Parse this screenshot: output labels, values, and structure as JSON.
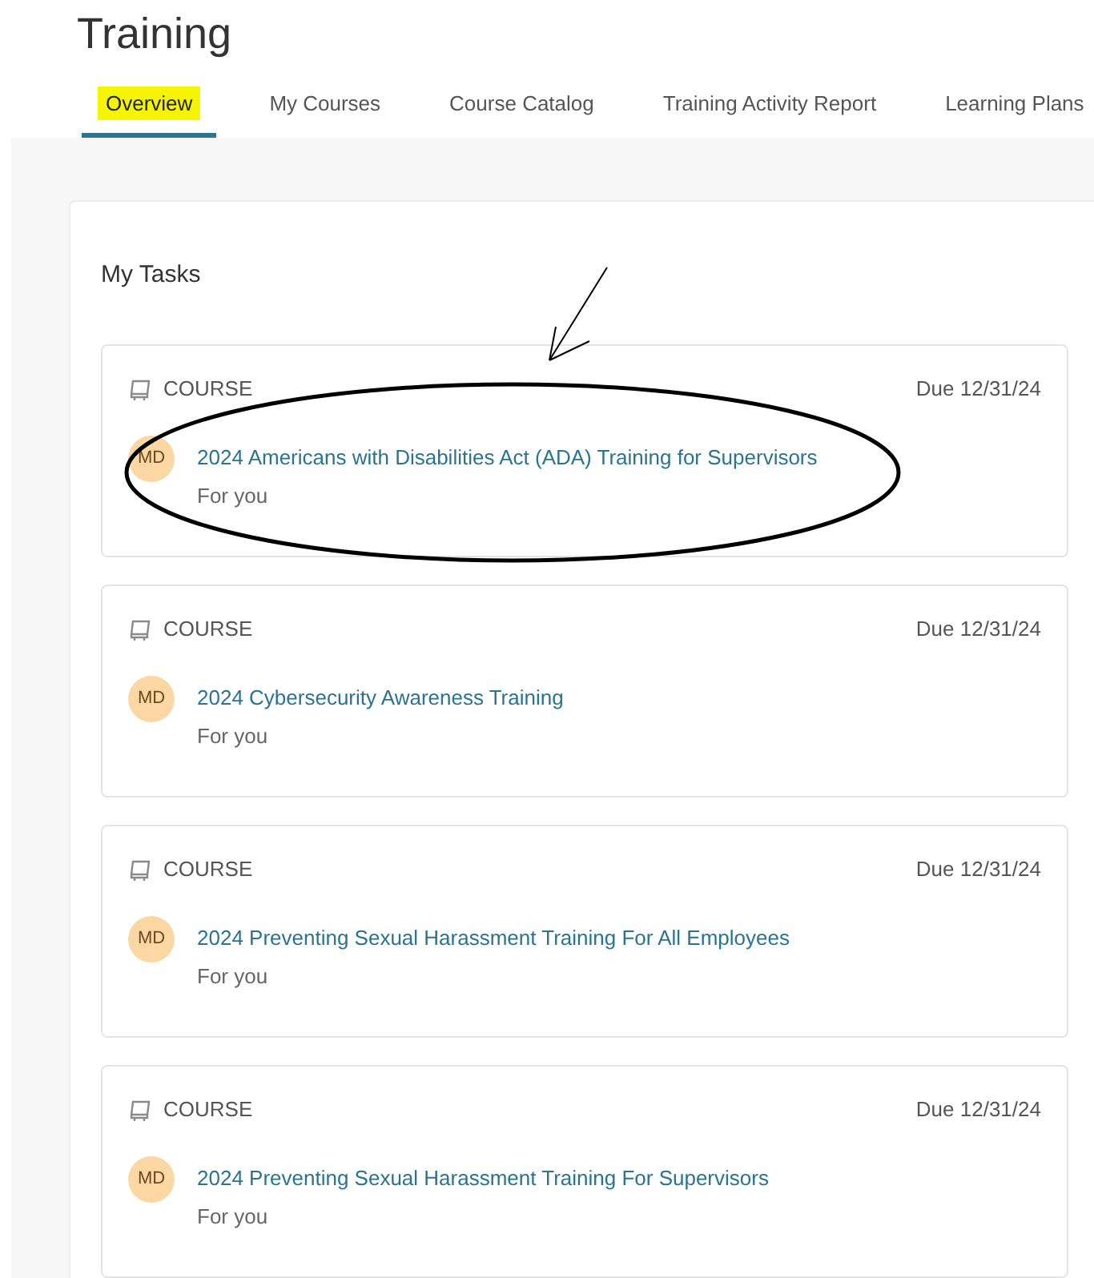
{
  "page": {
    "title": "Training"
  },
  "tabs": [
    {
      "label": "Overview",
      "selected": true,
      "highlighted": true
    },
    {
      "label": "My Courses",
      "selected": false,
      "highlighted": false
    },
    {
      "label": "Course Catalog",
      "selected": false,
      "highlighted": false
    },
    {
      "label": "Training Activity Report",
      "selected": false,
      "highlighted": false
    },
    {
      "label": "Learning Plans",
      "selected": false,
      "highlighted": false
    }
  ],
  "tasks_panel": {
    "title": "My Tasks",
    "tasks": [
      {
        "type": "COURSE",
        "due": "Due 12/31/24",
        "initials": "MD",
        "title": "2024 Americans with Disabilities Act (ADA) Training for Supervisors",
        "assignee": "For you",
        "circled": true
      },
      {
        "type": "COURSE",
        "due": "Due 12/31/24",
        "initials": "MD",
        "title": "2024 Cybersecurity Awareness Training",
        "assignee": "For you",
        "circled": false
      },
      {
        "type": "COURSE",
        "due": "Due 12/31/24",
        "initials": "MD",
        "title": "2024 Preventing Sexual Harassment Training For All Employees",
        "assignee": "For you",
        "circled": false
      },
      {
        "type": "COURSE",
        "due": "Due 12/31/24",
        "initials": "MD",
        "title": "2024 Preventing Sexual Harassment Training For Supervisors",
        "assignee": "For you",
        "circled": false
      }
    ]
  }
}
